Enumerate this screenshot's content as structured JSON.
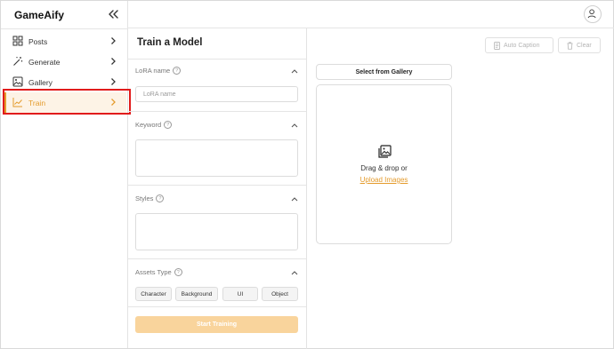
{
  "app": {
    "name": "GameAify"
  },
  "sidebar": {
    "items": [
      {
        "label": "Posts",
        "icon": "grid-icon"
      },
      {
        "label": "Generate",
        "icon": "magic-wand-icon"
      },
      {
        "label": "Gallery",
        "icon": "image-icon"
      },
      {
        "label": "Train",
        "icon": "chart-line-icon",
        "active": true
      }
    ]
  },
  "form": {
    "title": "Train a Model",
    "lora": {
      "label": "LoRA name",
      "placeholder": "LoRA name",
      "value": ""
    },
    "keyword": {
      "label": "Keyword",
      "value": ""
    },
    "styles": {
      "label": "Styles",
      "value": ""
    },
    "assets": {
      "label": "Assets Type",
      "options": [
        "Character",
        "Background",
        "UI",
        "Object"
      ]
    },
    "start_label": "Start Training"
  },
  "toolbar": {
    "auto_caption_label": "Auto Caption",
    "clear_label": "Clear"
  },
  "upload": {
    "gallery_button": "Select from Gallery",
    "drag_text": "Drag & drop or",
    "link_text": "Upload Images"
  },
  "colors": {
    "accent": "#e49b2c",
    "active_bg": "#fdf3e6",
    "start_button": "#f9d49c",
    "highlight_border": "#e11b1b"
  }
}
